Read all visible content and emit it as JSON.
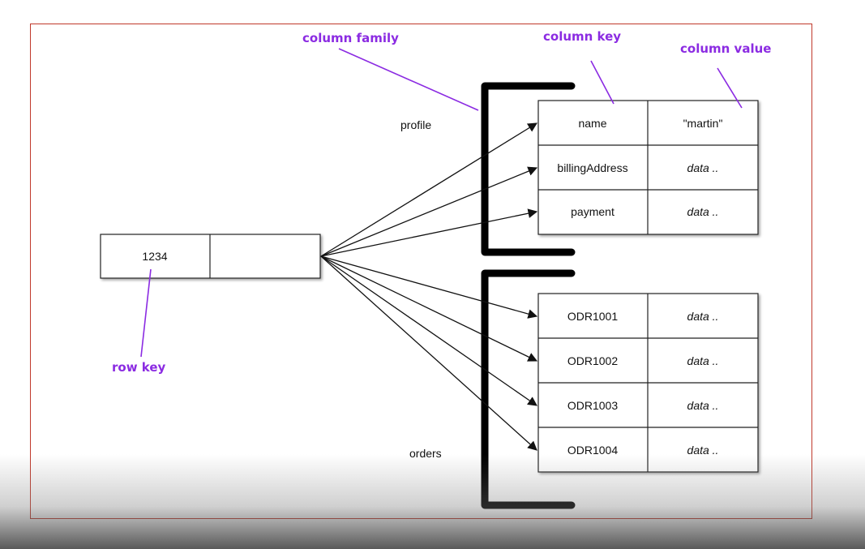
{
  "annotations": {
    "column_family": "column family",
    "column_key": "column key",
    "column_value": "column value",
    "row_key": "row key"
  },
  "row": {
    "key": "1234",
    "value": ""
  },
  "families": [
    {
      "label": "profile",
      "columns": [
        {
          "key": "name",
          "value": "\"martin\"",
          "italic": false
        },
        {
          "key": "billingAddress",
          "value": "data ..",
          "italic": true
        },
        {
          "key": "payment",
          "value": "data ..",
          "italic": true
        }
      ]
    },
    {
      "label": "orders",
      "columns": [
        {
          "key": "ODR1001",
          "value": "data ..",
          "italic": true
        },
        {
          "key": "ODR1002",
          "value": "data ..",
          "italic": true
        },
        {
          "key": "ODR1003",
          "value": "data ..",
          "italic": true
        },
        {
          "key": "ODR1004",
          "value": "data ..",
          "italic": true
        }
      ]
    }
  ],
  "colors": {
    "annotation": "#8b2be2",
    "frame": "#c0392b",
    "ink": "#111111"
  }
}
